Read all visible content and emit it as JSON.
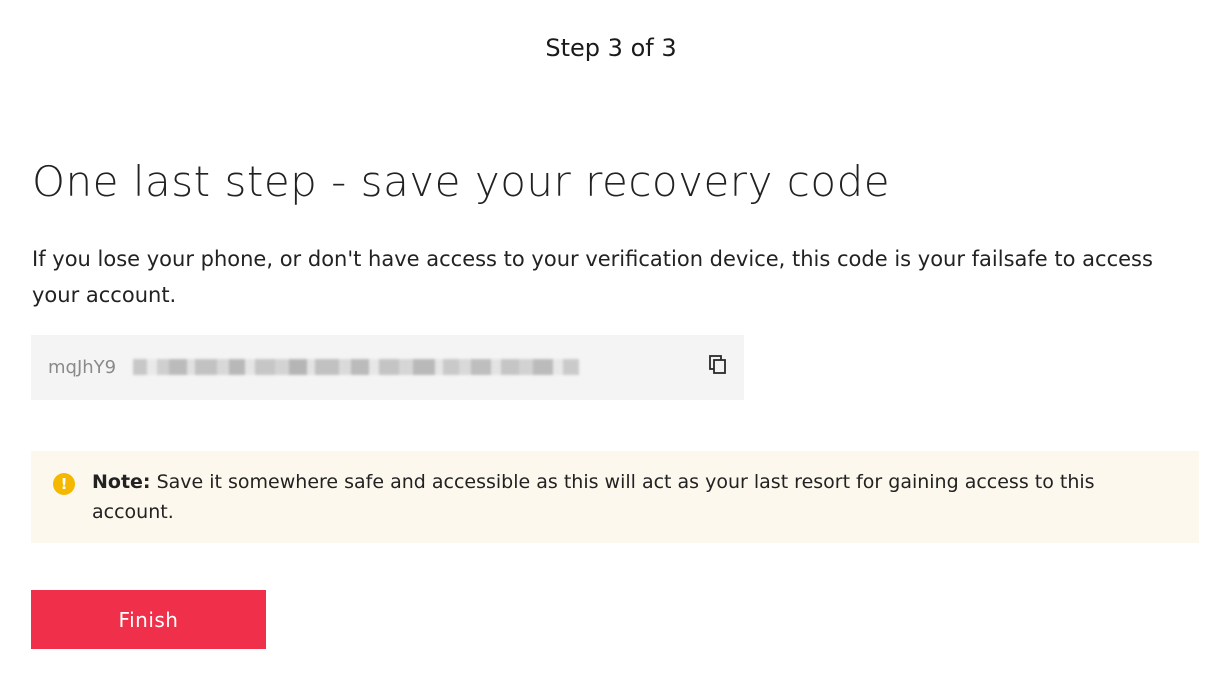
{
  "header": {
    "step_indicator": "Step 3 of 3"
  },
  "main": {
    "title": "One last step - save your recovery code",
    "description": "If you lose your phone, or don't have access to your verification device, this code is your failsafe to access your account.",
    "recovery_code": {
      "visible_prefix": "mqJhY9",
      "copy_icon": "copy-icon"
    },
    "note": {
      "icon": "info-icon",
      "icon_glyph": "!",
      "label": "Note:",
      "text": " Save it somewhere safe and accessible as this will act as your last resort for gaining access to this account."
    },
    "finish_button": {
      "label": "Finish",
      "color": "#f0304a"
    }
  }
}
